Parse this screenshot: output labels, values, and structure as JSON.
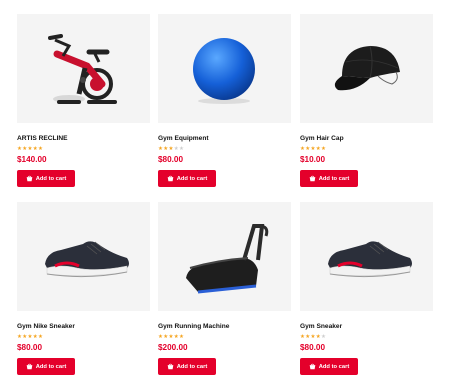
{
  "colors": {
    "accent": "#e4002b",
    "star_filled": "#f5a623",
    "star_empty": "#cfcfcf",
    "image_bg": "#f4f4f4"
  },
  "products": [
    {
      "name": "ARTIS RECLINE",
      "rating": 5,
      "price": "$140.00",
      "cta": "Add to cart",
      "image": "exercise-bike"
    },
    {
      "name": "Gym Equipment",
      "rating": 3,
      "price": "$80.00",
      "cta": "Add to cart",
      "image": "exercise-ball"
    },
    {
      "name": "Gym Hair Cap",
      "rating": 5,
      "price": "$10.00",
      "cta": "Add to cart",
      "image": "cap"
    },
    {
      "name": "Gym Nike Sneaker",
      "rating": 5,
      "price": "$80.00",
      "cta": "Add to cart",
      "image": "sneaker"
    },
    {
      "name": "Gym Running Machine",
      "rating": 5,
      "price": "$200.00",
      "cta": "Add to cart",
      "image": "treadmill"
    },
    {
      "name": "Gym Sneaker",
      "rating": 4,
      "price": "$80.00",
      "cta": "Add to cart",
      "image": "sneaker"
    }
  ]
}
